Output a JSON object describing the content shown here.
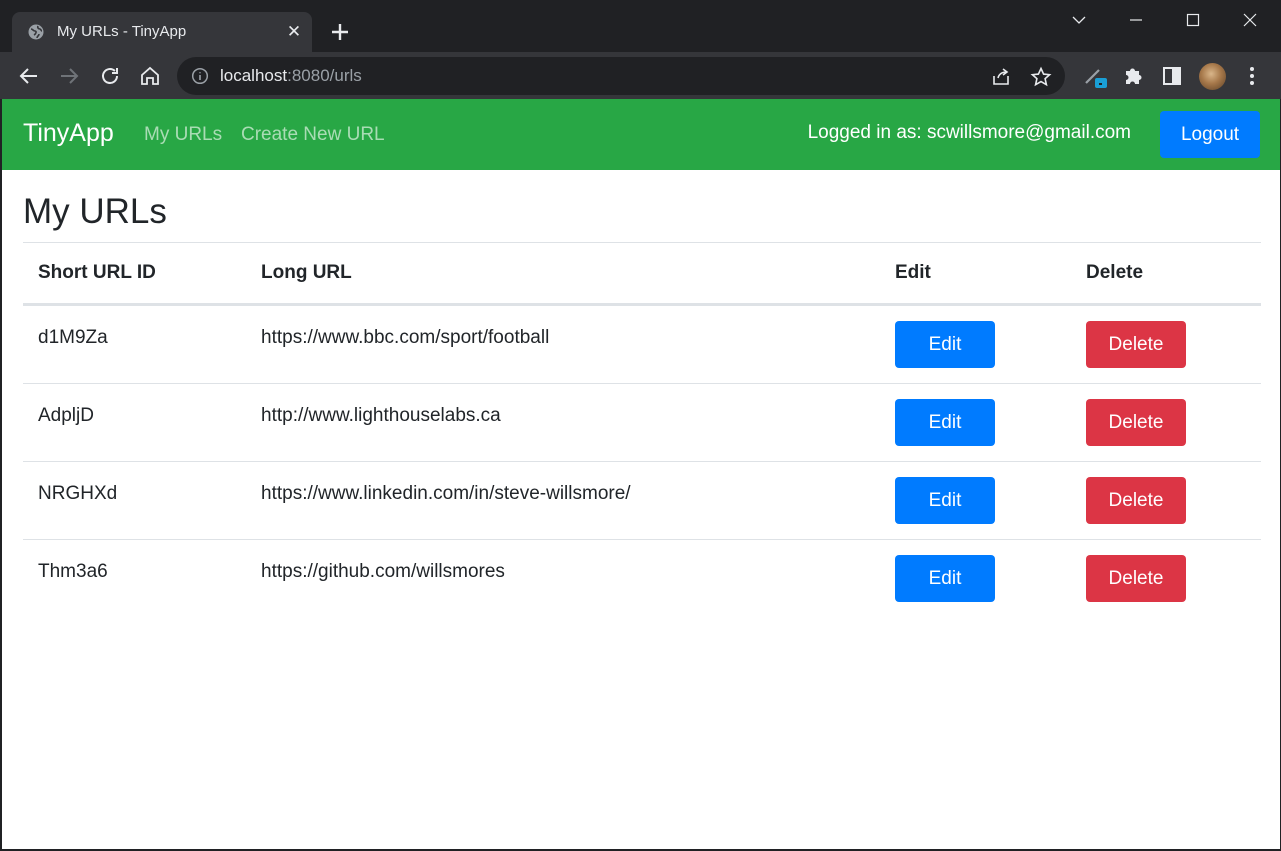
{
  "browser": {
    "tab_title": "My URLs - TinyApp",
    "url_host": "localhost",
    "url_rest": ":8080/urls",
    "icons": [
      "globe-icon",
      "close-icon",
      "plus-icon",
      "chevron-down-icon",
      "minimize-icon",
      "maximize-icon",
      "window-close-icon",
      "back-icon",
      "forward-icon",
      "reload-icon",
      "home-icon",
      "info-icon",
      "share-icon",
      "star-icon",
      "extension-tool-icon",
      "puzzle-icon",
      "sidepanel-icon",
      "avatar",
      "more-icon"
    ]
  },
  "navbar": {
    "brand": "TinyApp",
    "links": [
      "My URLs",
      "Create New URL"
    ],
    "logged_in_text": "Logged in as: scwillsmore@gmail.com",
    "logout_label": "Logout",
    "color": "#28a745"
  },
  "main": {
    "title": "My URLs",
    "columns": [
      "Short URL ID",
      "Long URL",
      "Edit",
      "Delete"
    ],
    "rows": [
      {
        "id": "d1M9Za",
        "long_url": "https://www.bbc.com/sport/football",
        "edit": "Edit",
        "delete": "Delete"
      },
      {
        "id": "AdpljD",
        "long_url": "http://www.lighthouselabs.ca",
        "edit": "Edit",
        "delete": "Delete"
      },
      {
        "id": "NRGHXd",
        "long_url": "https://www.linkedin.com/in/steve-willsmore/",
        "edit": "Edit",
        "delete": "Delete"
      },
      {
        "id": "Thm3a6",
        "long_url": "https://github.com/willsmores",
        "edit": "Edit",
        "delete": "Delete"
      }
    ],
    "colors": {
      "edit": "#007bff",
      "delete": "#dc3545"
    }
  }
}
